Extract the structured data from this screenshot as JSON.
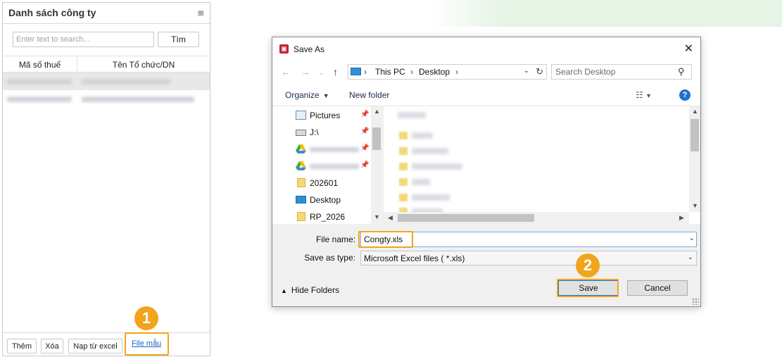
{
  "panel": {
    "title": "Danh sách công ty",
    "pin_icon": "pin-icon",
    "search_placeholder": "Enter text to search...",
    "search_button": "Tìm",
    "columns": [
      "Mã số thuế",
      "Tên Tổ chức/DN"
    ],
    "footer": {
      "add": "Thêm",
      "delete": "Xóa",
      "import": "Nạp từ excel",
      "template_link": "File mẫu"
    }
  },
  "steps": [
    "1",
    "2"
  ],
  "dialog": {
    "title": "Save As",
    "breadcrumb": [
      "This PC",
      "Desktop"
    ],
    "search_placeholder": "Search Desktop",
    "toolbar": {
      "organize": "Organize",
      "new_folder": "New folder"
    },
    "nav_items": [
      {
        "label": "Pictures",
        "icon": "pictures-icon"
      },
      {
        "label": "J:\\",
        "icon": "drive-icon"
      },
      {
        "label": "",
        "icon": "google-drive-icon"
      },
      {
        "label": "",
        "icon": "google-drive-icon"
      },
      {
        "label": "202601",
        "icon": "folder-icon"
      },
      {
        "label": "Desktop",
        "icon": "desktop-icon"
      },
      {
        "label": "RP_2026",
        "icon": "folder-icon"
      }
    ],
    "file_name_label": "File name:",
    "file_name_value": "Congty.xls",
    "save_as_type_label": "Save as type:",
    "save_as_type_value": "Microsoft Excel files  ( *.xls)",
    "hide_folders": "Hide Folders",
    "save_button": "Save",
    "cancel_button": "Cancel"
  },
  "colors": {
    "highlight": "#f2a41c",
    "link": "#1a63c5",
    "accent": "#0078d7"
  }
}
